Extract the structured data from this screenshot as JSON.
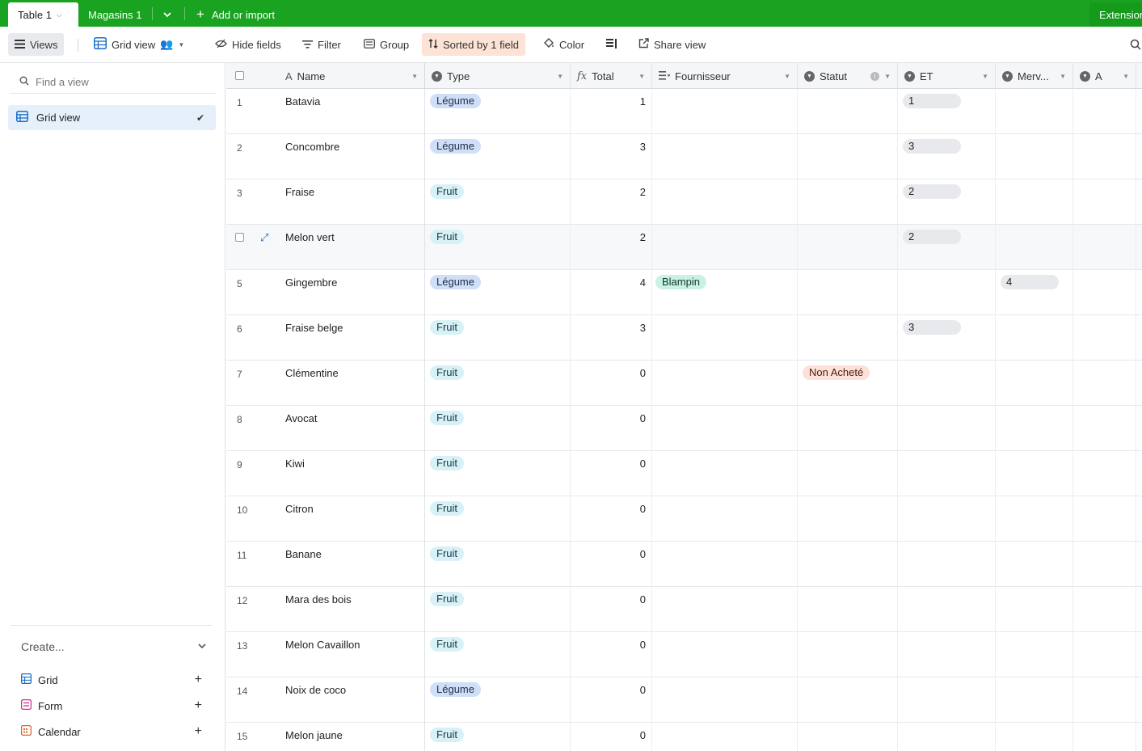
{
  "tabs": {
    "active": "Table 1",
    "second": "Magasins 1",
    "add": "Add or import",
    "extensions": "Extensions"
  },
  "toolbar": {
    "views": "Views",
    "grid_view": "Grid view",
    "hide_fields": "Hide fields",
    "filter": "Filter",
    "group": "Group",
    "sorted": "Sorted by 1 field",
    "color": "Color",
    "share": "Share view"
  },
  "sidebar": {
    "find_placeholder": "Find a view",
    "current_view": "Grid view",
    "create": "Create...",
    "create_items": [
      "Grid",
      "Form",
      "Calendar"
    ]
  },
  "columns": [
    "Name",
    "Type",
    "Total",
    "Fournisseur",
    "Statut",
    "ET",
    "Merv...",
    "A"
  ],
  "rows": [
    {
      "n": "1",
      "name": "Batavia",
      "type": "Légume",
      "total": "1",
      "four": "",
      "statut": "",
      "et": "1",
      "merv": ""
    },
    {
      "n": "2",
      "name": "Concombre",
      "type": "Légume",
      "total": "3",
      "four": "",
      "statut": "",
      "et": "3",
      "merv": ""
    },
    {
      "n": "3",
      "name": "Fraise",
      "type": "Fruit",
      "total": "2",
      "four": "",
      "statut": "",
      "et": "2",
      "merv": ""
    },
    {
      "n": "",
      "name": "Melon vert",
      "type": "Fruit",
      "total": "2",
      "four": "",
      "statut": "",
      "et": "2",
      "merv": ""
    },
    {
      "n": "5",
      "name": "Gingembre",
      "type": "Légume",
      "total": "4",
      "four": "Blampin",
      "statut": "",
      "et": "",
      "merv": "4"
    },
    {
      "n": "6",
      "name": "Fraise belge",
      "type": "Fruit",
      "total": "3",
      "four": "",
      "statut": "",
      "et": "3",
      "merv": ""
    },
    {
      "n": "7",
      "name": "Clémentine",
      "type": "Fruit",
      "total": "0",
      "four": "",
      "statut": "Non Acheté",
      "et": "",
      "merv": ""
    },
    {
      "n": "8",
      "name": "Avocat",
      "type": "Fruit",
      "total": "0",
      "four": "",
      "statut": "",
      "et": "",
      "merv": ""
    },
    {
      "n": "9",
      "name": "Kiwi",
      "type": "Fruit",
      "total": "0",
      "four": "",
      "statut": "",
      "et": "",
      "merv": ""
    },
    {
      "n": "10",
      "name": "Citron",
      "type": "Fruit",
      "total": "0",
      "four": "",
      "statut": "",
      "et": "",
      "merv": ""
    },
    {
      "n": "11",
      "name": "Banane",
      "type": "Fruit",
      "total": "0",
      "four": "",
      "statut": "",
      "et": "",
      "merv": ""
    },
    {
      "n": "12",
      "name": "Mara des bois",
      "type": "Fruit",
      "total": "0",
      "four": "",
      "statut": "",
      "et": "",
      "merv": ""
    },
    {
      "n": "13",
      "name": "Melon Cavaillon",
      "type": "Fruit",
      "total": "0",
      "four": "",
      "statut": "",
      "et": "",
      "merv": ""
    },
    {
      "n": "14",
      "name": "Noix de coco",
      "type": "Légume",
      "total": "0",
      "four": "",
      "statut": "",
      "et": "",
      "merv": ""
    },
    {
      "n": "15",
      "name": "Melon jaune",
      "type": "Fruit",
      "total": "0",
      "four": "",
      "statut": "",
      "et": "",
      "merv": ""
    }
  ]
}
